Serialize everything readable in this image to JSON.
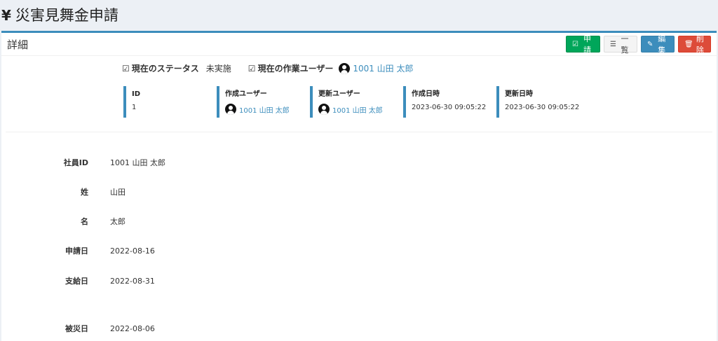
{
  "page": {
    "title": "災害見舞金申請",
    "title_icon": "yen-icon"
  },
  "box": {
    "title": "詳細",
    "buttons": {
      "apply": "申請",
      "list": "一覧",
      "edit": "編集",
      "delete": "削除"
    }
  },
  "status": {
    "status_label": "現在のステータス",
    "status_value": "未実施",
    "worker_label": "現在の作業ユーザー",
    "worker_value": "1001 山田 太郎"
  },
  "meta": {
    "id_label": "ID",
    "id_value": "1",
    "created_by_label": "作成ユーザー",
    "created_by_value": "1001 山田 太郎",
    "updated_by_label": "更新ユーザー",
    "updated_by_value": "1001 山田 太郎",
    "created_at_label": "作成日時",
    "created_at_value": "2023-06-30 09:05:22",
    "updated_at_label": "更新日時",
    "updated_at_value": "2023-06-30 09:05:22"
  },
  "fields": {
    "employee_id_label": "社員ID",
    "employee_id_value": "1001 山田 太郎",
    "last_name_label": "姓",
    "last_name_value": "山田",
    "first_name_label": "名",
    "first_name_value": "太郎",
    "apply_date_label": "申請日",
    "apply_date_value": "2022-08-16",
    "pay_date_label": "支給日",
    "pay_date_value": "2022-08-31",
    "disaster_date_label": "被災日",
    "disaster_date_value": "2022-08-06"
  },
  "colors": {
    "accent": "#3c8dbc",
    "success": "#00a65a",
    "danger": "#dd4b39",
    "background": "#ecf0f5"
  }
}
